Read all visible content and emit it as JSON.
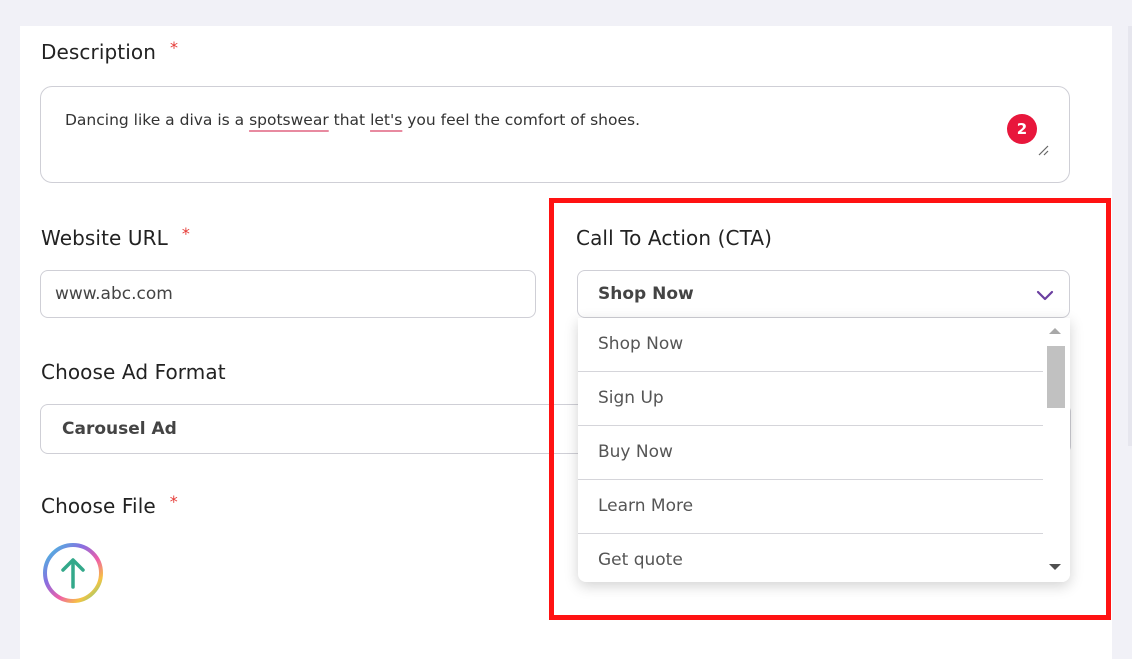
{
  "form": {
    "description": {
      "label": "Description",
      "required_mark": "*",
      "value_parts": [
        "Dancing like a diva is a ",
        "spotswear",
        " that ",
        "let's",
        " you feel the comfort of shoes."
      ],
      "char_badge": "2"
    },
    "website_url": {
      "label": "Website URL",
      "required_mark": "*",
      "value": "www.abc.com"
    },
    "cta": {
      "label": "Call To Action (CTA)",
      "selected": "Shop Now",
      "options": [
        "Shop Now",
        "Sign Up",
        "Buy Now",
        "Learn More",
        "Get quote"
      ]
    },
    "ad_format": {
      "label": "Choose Ad Format",
      "selected": "Carousel Ad"
    },
    "file": {
      "label": "Choose File",
      "required_mark": "*",
      "upload_icon": "upload-arrow-icon"
    }
  },
  "colors": {
    "required": "#e53935",
    "badge": "#e8173c",
    "highlight_border": "#ff1212",
    "chevron": "#6b3fa0"
  }
}
